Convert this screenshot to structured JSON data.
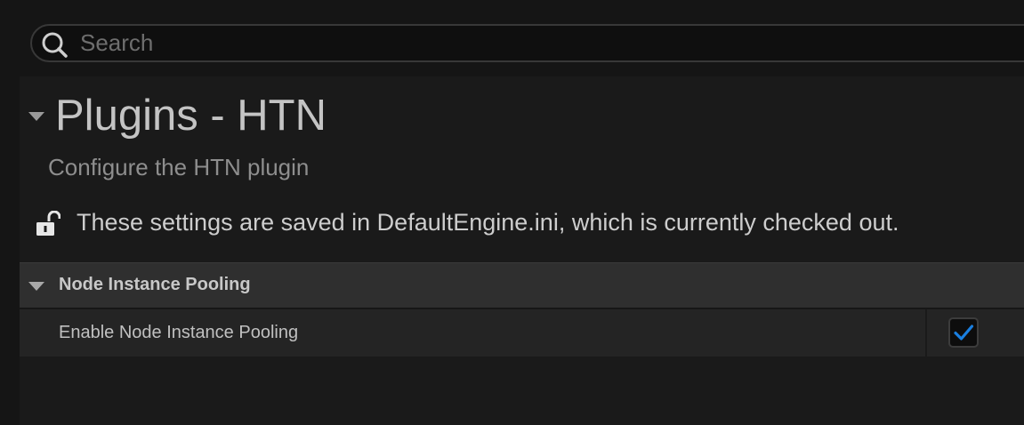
{
  "search": {
    "placeholder": "Search",
    "value": ""
  },
  "section": {
    "title": "Plugins - HTN",
    "subtitle": "Configure the HTN plugin",
    "notice": "These settings are saved in DefaultEngine.ini, which is currently checked out.",
    "notice_icon": "unlocked-padlock-icon"
  },
  "category": {
    "label": "Node Instance Pooling",
    "expanded": true
  },
  "properties": [
    {
      "label": "Enable Node Instance Pooling",
      "checked": true
    }
  ],
  "colors": {
    "background": "#151515",
    "panel": "#1a1a1a",
    "category_header": "#2f2f2f",
    "property_row": "#242424",
    "checkmark": "#1a7fe0"
  }
}
